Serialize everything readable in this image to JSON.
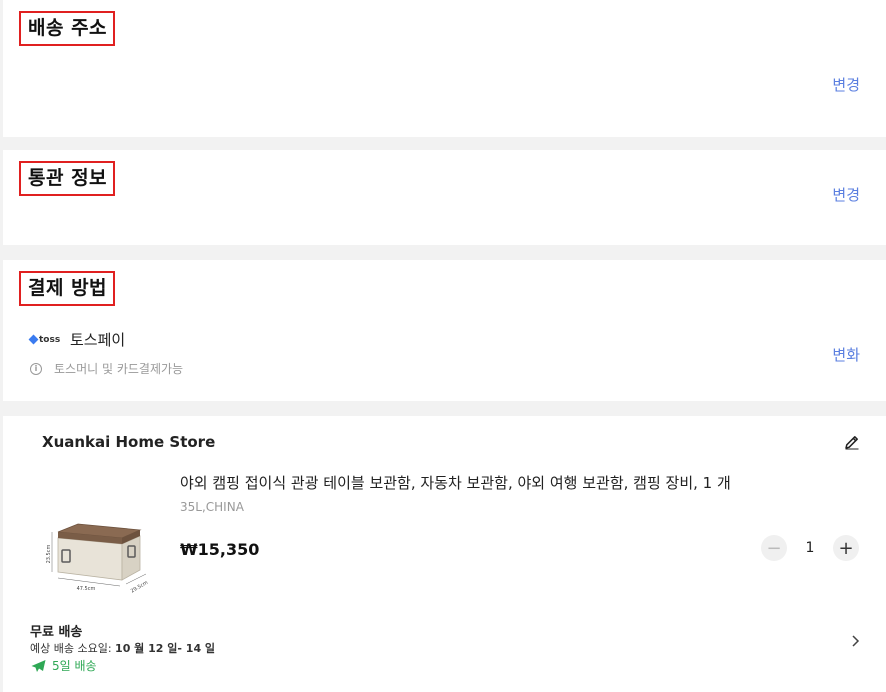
{
  "shipping_address": {
    "title": "배송 주소",
    "change_label": "변경"
  },
  "customs_info": {
    "title": "통관 정보",
    "change_label": "변경"
  },
  "payment": {
    "title": "결제 방법",
    "logo_text": "toss",
    "method_name": "토스페이",
    "note": "토스머니 및 카드결제가능",
    "change_label": "변화"
  },
  "order": {
    "store_name": "Xuankai Home Store",
    "product": {
      "title": "야외 캠핑 접이식 관광 테이블 보관함, 자동차 보관함, 야외 여행 보관함, 캠핑 장비, 1 개",
      "variant": "35L,CHINA",
      "price": "₩15,350",
      "quantity": "1",
      "dim_height": "23.5cm",
      "dim_width": "47.5cm",
      "dim_depth": "29.5cm"
    },
    "shipping": {
      "title": "무료 배송",
      "eta_label": "예상 배송 소요일:",
      "eta_value": "10 월 12 일- 14 일",
      "days": "5일 배송"
    }
  },
  "colors": {
    "accent_link": "#5b7fe0",
    "highlight_border": "#e02020",
    "shipping_green": "#2fa855"
  }
}
